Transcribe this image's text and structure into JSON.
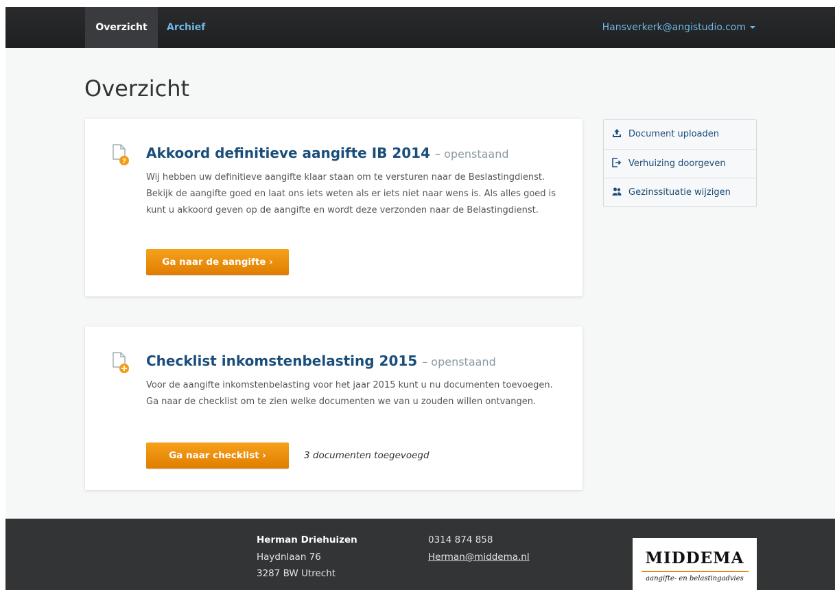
{
  "nav": {
    "active_tab": "Overzicht",
    "tab_archief": "Archief",
    "user": "Hansverkerk@angistudio.com"
  },
  "page": {
    "title": "Overzicht"
  },
  "cards": [
    {
      "title": "Akkoord definitieve aangifte IB 2014",
      "status": "– openstaand",
      "text": "Wij hebben uw definitieve aangifte klaar staan om te versturen naar de Beslastingdienst. Bekijk de aangifte goed en laat ons iets weten als er iets niet naar wens is.  Als alles goed is kunt u akkoord geven op de aangifte en wordt deze verzonden naar de Belastingdienst.",
      "button": "Ga naar de aangifte ›",
      "icon": "document-question-icon"
    },
    {
      "title": "Checklist inkomstenbelasting 2015",
      "status": "– openstaand",
      "text": "Voor de aangifte inkomstenbelasting voor het jaar 2015 kunt u nu documenten toevoegen. Ga naar de checklist om te zien welke documenten we van u zouden willen ontvangen.",
      "button": "Ga naar checklist ›",
      "note": "3 documenten toegevoegd",
      "icon": "document-add-icon"
    }
  ],
  "sidebar": {
    "items": [
      {
        "label": "Document uploaden",
        "icon": "upload-icon"
      },
      {
        "label": "Verhuizing doorgeven",
        "icon": "sign-out-icon"
      },
      {
        "label": "Gezinssituatie wijzigen",
        "icon": "users-icon"
      }
    ]
  },
  "footer": {
    "name": "Herman Driehuizen",
    "street": "Haydnlaan 76",
    "city": "3287 BW Utrecht",
    "phone": "0314 874 858",
    "email": "Herman@middema.nl",
    "logo_main": "MIDDEMA",
    "logo_sub": "aangifte- en belastingadvies"
  },
  "colors": {
    "accent": "#f39c12",
    "link": "#1a4d7a",
    "nav_link": "#6db8e4",
    "navbar": "#252628",
    "footer": "#333436"
  }
}
